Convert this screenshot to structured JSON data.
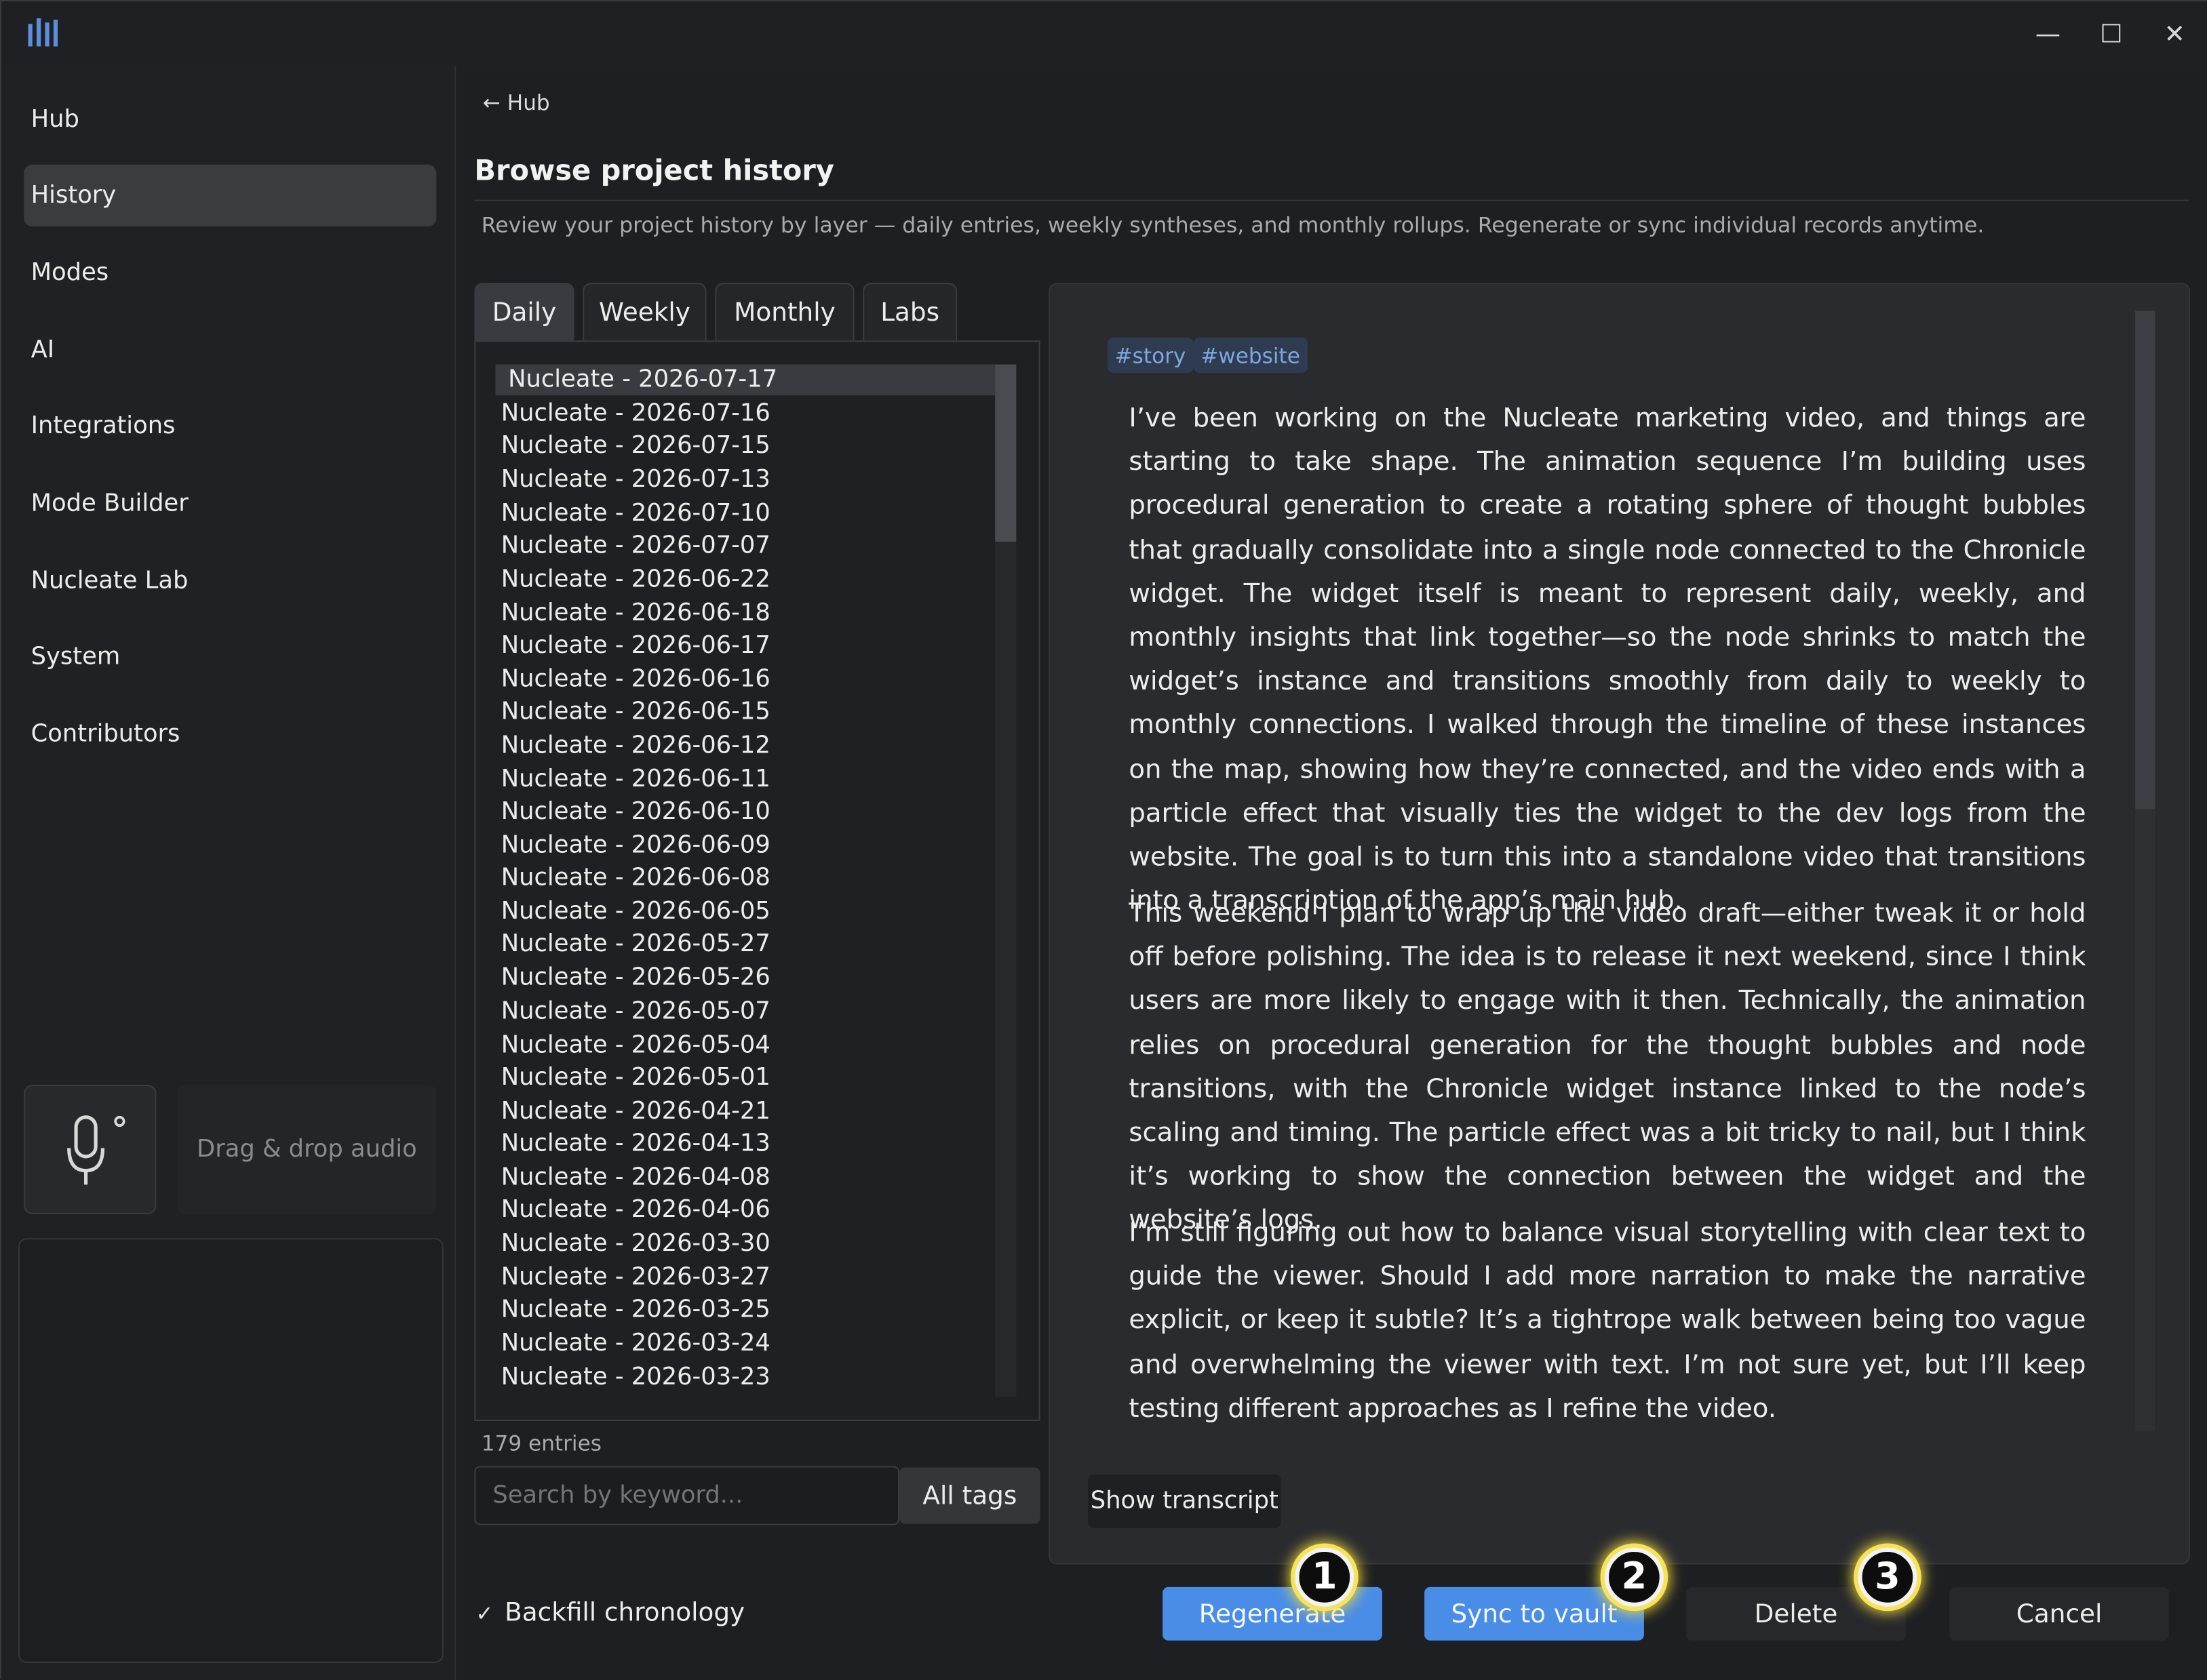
{
  "window": {
    "app_icon": "equalizer-logo-icon",
    "controls": {
      "minimize": "—",
      "maximize": "☐",
      "close": "✕"
    }
  },
  "sidebar": {
    "items": [
      {
        "label": "Hub"
      },
      {
        "label": "History",
        "active": true
      },
      {
        "label": "Modes"
      },
      {
        "label": "AI"
      },
      {
        "label": "Integrations"
      },
      {
        "label": "Mode Builder"
      },
      {
        "label": "Nucleate Lab"
      },
      {
        "label": "System"
      },
      {
        "label": "Contributors"
      }
    ],
    "drop_zone_label": "Drag & drop audio",
    "mic_icon": "microphone-icon"
  },
  "main": {
    "back_link": "← Hub",
    "title": "Browse project history",
    "description": "Review your project history by layer — daily entries, weekly syntheses, and monthly rollups. Regenerate or sync individual records anytime.",
    "tabs": [
      {
        "label": "Daily",
        "active": true
      },
      {
        "label": "Weekly"
      },
      {
        "label": "Monthly"
      },
      {
        "label": "Labs"
      }
    ],
    "entries": [
      "Nucleate - 2026-07-17",
      "Nucleate - 2026-07-16",
      "Nucleate - 2026-07-15",
      "Nucleate - 2026-07-13",
      "Nucleate - 2026-07-10",
      "Nucleate - 2026-07-07",
      "Nucleate - 2026-06-22",
      "Nucleate - 2026-06-18",
      "Nucleate - 2026-06-17",
      "Nucleate - 2026-06-16",
      "Nucleate - 2026-06-15",
      "Nucleate - 2026-06-12",
      "Nucleate - 2026-06-11",
      "Nucleate - 2026-06-10",
      "Nucleate - 2026-06-09",
      "Nucleate - 2026-06-08",
      "Nucleate - 2026-06-05",
      "Nucleate - 2026-05-27",
      "Nucleate - 2026-05-26",
      "Nucleate - 2026-05-07",
      "Nucleate - 2026-05-04",
      "Nucleate - 2026-05-01",
      "Nucleate - 2026-04-21",
      "Nucleate - 2026-04-13",
      "Nucleate - 2026-04-08",
      "Nucleate - 2026-04-06",
      "Nucleate - 2026-03-30",
      "Nucleate - 2026-03-27",
      "Nucleate - 2026-03-25",
      "Nucleate - 2026-03-24",
      "Nucleate - 2026-03-23"
    ],
    "entry_count": "179 entries",
    "search_placeholder": "Search by keyword...",
    "tag_filter": "All tags",
    "backfill": {
      "checked": true,
      "check_glyph": "✓",
      "label": "Backfill chronology"
    }
  },
  "content": {
    "tags": [
      "#story",
      "#website"
    ],
    "paragraphs": [
      "I’ve been working on the Nucleate marketing video, and things are starting to take shape. The animation sequence I’m building uses procedural generation to create a rotating sphere of thought bubbles that gradually consolidate into a single node connected to the Chronicle widget. The widget itself is meant to represent daily, weekly, and monthly insights that link together—so the node shrinks to match the widget’s instance and transitions smoothly from daily to weekly to monthly connections. I walked through the timeline of these instances on the map, showing how they’re connected, and the video ends with a particle effect that visually ties the widget to the dev logs from the website. The goal is to turn this into a standalone video that transitions into a transcription of the app’s main hub.",
      "This weekend I plan to wrap up the video draft—either tweak it or hold off before polishing. The idea is to release it next weekend, since I think users are more likely to engage with it then. Technically, the animation relies on procedural generation for the thought bubbles and node transitions, with the Chronicle widget instance linked to the node’s scaling and timing. The particle effect was a bit tricky to nail, but I think it’s working to show the connection between the widget and the website’s logs.",
      "I’m still figuring out how to balance visual storytelling with clear text to guide the viewer. Should I add more narration to make the narrative explicit, or keep it subtle? It’s a tightrope walk between being too vague and overwhelming the viewer with text. I’m not sure yet, but I’ll keep testing different approaches as I refine the video."
    ],
    "show_transcript": "Show transcript"
  },
  "actions": {
    "regenerate": "Regenerate",
    "sync": "Sync to vault",
    "delete": "Delete",
    "cancel": "Cancel"
  },
  "badges": [
    "1",
    "2",
    "3"
  ],
  "colors": {
    "accent": "#4a8de6",
    "tag_text": "#7fa6df",
    "badge_glow": "#f7e35a"
  }
}
